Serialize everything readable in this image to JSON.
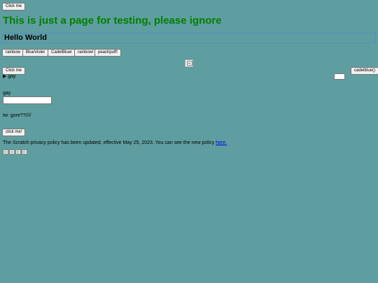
{
  "top_button": {
    "label": "Click me"
  },
  "heading": {
    "text": "This is just a page for testing, please ignore"
  },
  "hello": {
    "text": "Hello World"
  },
  "color_buttons": [
    {
      "label": "rainbow"
    },
    {
      "label": "BlueViolet"
    },
    {
      "label": "CadetBluer"
    },
    {
      "label": "rainbow!"
    },
    {
      "label": "peachpuff!"
    }
  ],
  "second_button": {
    "label": "Click me"
  },
  "details": {
    "marker": "▶",
    "summary": "gay"
  },
  "cadet_button": {
    "label": "cadetblue()"
  },
  "input_label": {
    "text": "gay"
  },
  "text_input": {
    "value": ""
  },
  "tw_text": {
    "text": "tw: gore??////"
  },
  "click_me_bang": {
    "label": "click me!"
  },
  "privacy": {
    "text": "The Scratch privacy policy has been updated, effective May 25, 2023. You can see the new policy",
    "link_text": "here."
  },
  "colors": {
    "background": "#5f9ea0",
    "heading": "#008000",
    "link": "#0000ee"
  }
}
